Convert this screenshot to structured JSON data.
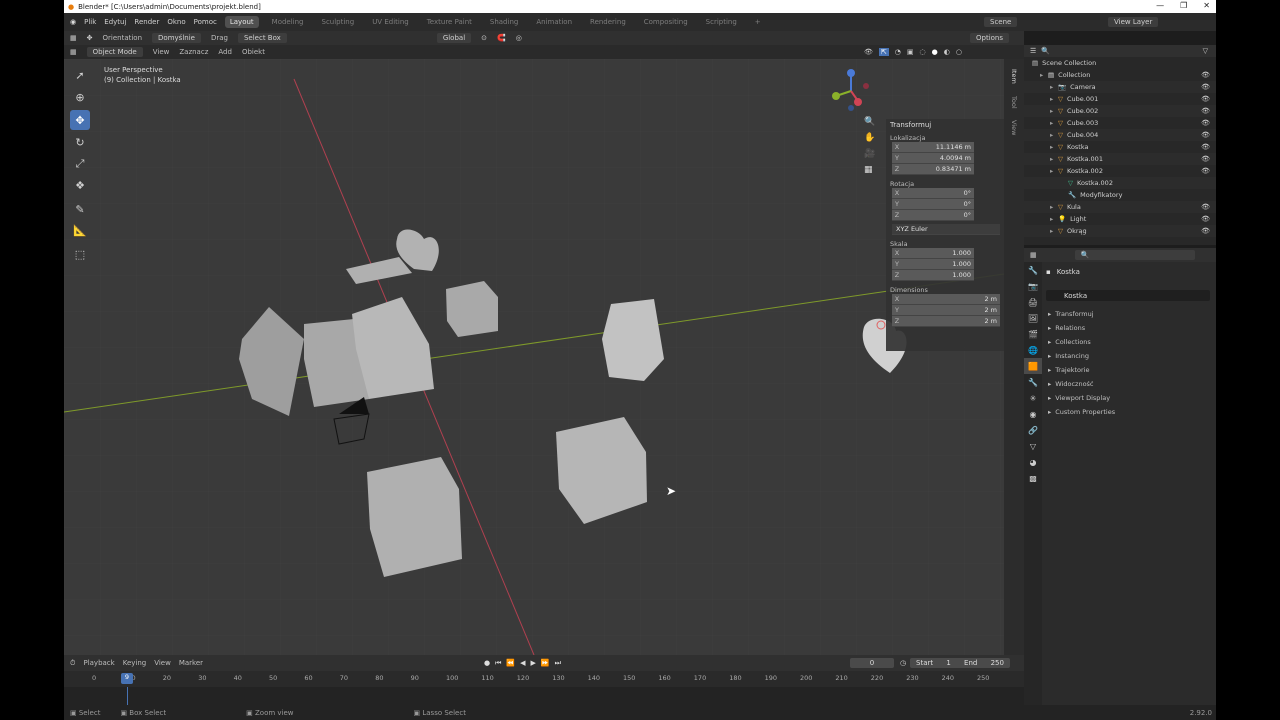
{
  "window": {
    "title": "Blender* [C:\\Users\\admin\\Documents\\projekt.blend]"
  },
  "menu": {
    "items": [
      "Plik",
      "Edytuj",
      "Render",
      "Okno",
      "Pomoc"
    ],
    "workspaces": [
      "Layout",
      "Modeling",
      "Sculpting",
      "UV Editing",
      "Texture Paint",
      "Shading",
      "Animation",
      "Rendering",
      "Compositing",
      "Scripting"
    ],
    "add_tab": "+",
    "scene": "Scene",
    "view_layer": "View Layer"
  },
  "viewport_header": {
    "orientation": "Orientation",
    "default": "Domyślnie",
    "drag": "Drag",
    "select_box": "Select Box",
    "transform_orientation": "Global",
    "options": "Options",
    "mode": "Object Mode",
    "view_menus": [
      "View",
      "Zaznacz",
      "Add",
      "Obiekt"
    ]
  },
  "overlay_text": {
    "perspective": "User Perspective",
    "collection": "(9) Collection | Kostka"
  },
  "npanel": {
    "title": "Transformuj",
    "tabs": [
      "Item",
      "Tool",
      "View"
    ],
    "location_label": "Lokalizacja",
    "location": [
      "11.1146 m",
      "4.0094 m",
      "0.83471 m"
    ],
    "rotation_label": "Rotacja",
    "rotation": [
      "0°",
      "0°",
      "0°"
    ],
    "rotation_mode": "XYZ Euler",
    "scale_label": "Skala",
    "scale": [
      "1.000",
      "1.000",
      "1.000"
    ],
    "dimensions_label": "Dimensions",
    "dimensions": [
      "2 m",
      "2 m",
      "2 m"
    ],
    "axes": [
      "X",
      "Y",
      "Z"
    ]
  },
  "outliner": {
    "header": "Scene Collection",
    "items": [
      {
        "name": "Collection",
        "icon": "collection-icon",
        "depth": 1
      },
      {
        "name": "Camera",
        "icon": "camera-icon",
        "depth": 2
      },
      {
        "name": "Cube.001",
        "icon": "mesh-icon",
        "depth": 2
      },
      {
        "name": "Cube.002",
        "icon": "mesh-icon",
        "depth": 2
      },
      {
        "name": "Cube.003",
        "icon": "mesh-icon",
        "depth": 2
      },
      {
        "name": "Cube.004",
        "icon": "mesh-icon",
        "depth": 2
      },
      {
        "name": "Kostka",
        "icon": "mesh-icon",
        "depth": 2
      },
      {
        "name": "Kostka.001",
        "icon": "mesh-icon",
        "depth": 2
      },
      {
        "name": "Kostka.002",
        "icon": "mesh-icon",
        "depth": 2
      },
      {
        "name": "Kostka.002",
        "icon": "mesh-data-icon",
        "depth": 3
      },
      {
        "name": "Modyfikatory",
        "icon": "wrench-icon",
        "depth": 3
      },
      {
        "name": "Kula",
        "icon": "mesh-icon",
        "depth": 2
      },
      {
        "name": "Light",
        "icon": "light-icon",
        "depth": 2
      },
      {
        "name": "Okrąg",
        "icon": "mesh-icon",
        "depth": 2
      }
    ]
  },
  "properties": {
    "object_name": "Kostka",
    "name_field": "Kostka",
    "panels": [
      "Transformuj",
      "Relations",
      "Collections",
      "Instancing",
      "Trajektorie",
      "Widoczność",
      "Viewport Display",
      "Custom Properties"
    ]
  },
  "timeline": {
    "menus": [
      "Playback",
      "Keying",
      "View",
      "Marker"
    ],
    "current_frame": "0",
    "start_label": "Start",
    "start": "1",
    "end_label": "End",
    "end": "250",
    "playhead": "9",
    "ticks": [
      "0",
      "10",
      "20",
      "30",
      "40",
      "50",
      "60",
      "70",
      "80",
      "90",
      "100",
      "110",
      "120",
      "130",
      "140",
      "150",
      "160",
      "170",
      "180",
      "190",
      "200",
      "210",
      "220",
      "230",
      "240",
      "250"
    ]
  },
  "status": {
    "items": [
      "Select",
      "Box Select",
      "Zoom view",
      "Lasso Select"
    ],
    "version": "2.92.0"
  },
  "colors": {
    "accent": "#4772b3",
    "selected_row": "#334d80",
    "x_axis": "#c04050",
    "y_axis": "#8aa030"
  }
}
